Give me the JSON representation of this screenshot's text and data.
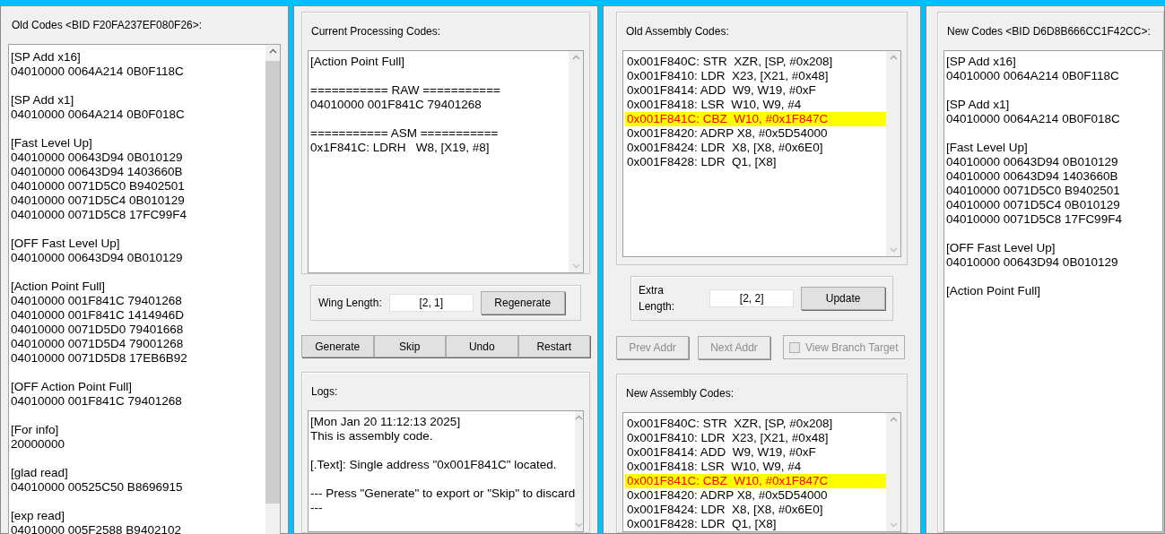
{
  "old_codes": {
    "title": "Old Codes <BID F20FA237EF080F26>:",
    "blocks": [
      [
        "[SP Add x16]",
        "04010000 0064A214 0B0F118C"
      ],
      [
        "[SP Add x1]",
        "04010000 0064A214 0B0F018C"
      ],
      [
        "[Fast Level Up]",
        "04010000 00643D94 0B010129",
        "04010000 00643D94 1403660B",
        "04010000 0071D5C0 B9402501",
        "04010000 0071D5C4 0B010129",
        "04010000 0071D5C8 17FC99F4"
      ],
      [
        "[OFF Fast Level Up]",
        "04010000 00643D94 0B010129"
      ],
      [
        "[Action Point Full]",
        "04010000 001F841C 79401268",
        "04010000 001F841C 1414946D",
        "04010000 0071D5D0 79401668",
        "04010000 0071D5D4 79001268",
        "04010000 0071D5D8 17EB6B92"
      ],
      [
        "[OFF Action Point Full]",
        "04010000 001F841C 79401268"
      ],
      [
        "[For info]",
        "20000000"
      ],
      [
        "[glad read]",
        "04010000 00525C50 B8696915"
      ],
      [
        "[exp read]",
        "04010000 005F2588 B9402102"
      ]
    ]
  },
  "current": {
    "title": "Current Processing Codes:",
    "blocks": [
      [
        "[Action Point Full]"
      ],
      [
        "=========== RAW ===========",
        "04010000 001F841C 79401268"
      ],
      [
        "=========== ASM ===========",
        "0x1F841C: LDRH   W8, [X19, #8]"
      ]
    ]
  },
  "wing": {
    "label": "Wing Length:",
    "value": "[2, 1]",
    "button": "Regenerate"
  },
  "actions": [
    {
      "label": "Generate"
    },
    {
      "label": "Skip"
    },
    {
      "label": "Undo"
    },
    {
      "label": "Restart"
    }
  ],
  "logs": {
    "title": "Logs:",
    "blocks": [
      [
        "[Mon Jan 20 11:12:13 2025]",
        "This is assembly code."
      ],
      [
        "[.Text]: Single address \"0x001F841C\" located."
      ],
      [
        "--- Press \"Generate\" to export or \"Skip\" to discard",
        "---"
      ]
    ]
  },
  "old_asm": {
    "title": "Old Assembly Codes:",
    "lines": [
      {
        "text": "0x001F840C: STR  XZR, [SP, #0x208]",
        "selected": false
      },
      {
        "text": "0x001F8410: LDR  X23, [X21, #0x48]",
        "selected": false
      },
      {
        "text": "0x001F8414: ADD  W9, W19, #0xF",
        "selected": false
      },
      {
        "text": "0x001F8418: LSR  W10, W9, #4",
        "selected": false
      },
      {
        "text": "0x001F841C: CBZ  W10, #0x1F847C",
        "selected": true
      },
      {
        "text": "0x001F8420: ADRP X8, #0x5D54000",
        "selected": false
      },
      {
        "text": "0x001F8424: LDR  X8, [X8, #0x6E0]",
        "selected": false
      },
      {
        "text": "0x001F8428: LDR  Q1, [X8]",
        "selected": false
      }
    ]
  },
  "extra": {
    "label": "Extra Length:",
    "value": "[2, 2]",
    "button": "Update"
  },
  "nav": [
    {
      "label": "Prev Addr",
      "disabled": true
    },
    {
      "label": "Next Addr",
      "disabled": true
    }
  ],
  "branch": {
    "label": "View Branch Target",
    "checked": false,
    "disabled": true
  },
  "new_asm": {
    "title": "New Assembly Codes:",
    "lines": [
      {
        "text": "0x001F840C: STR  XZR, [SP, #0x208]",
        "selected": false
      },
      {
        "text": "0x001F8410: LDR  X23, [X21, #0x48]",
        "selected": false
      },
      {
        "text": "0x001F8414: ADD  W9, W19, #0xF",
        "selected": false
      },
      {
        "text": "0x001F8418: LSR  W10, W9, #4",
        "selected": false
      },
      {
        "text": "0x001F841C: CBZ  W10, #0x1F847C",
        "selected": true
      },
      {
        "text": "0x001F8420: ADRP X8, #0x5D54000",
        "selected": false
      },
      {
        "text": "0x001F8424: LDR  X8, [X8, #0x6E0]",
        "selected": false
      },
      {
        "text": "0x001F8428: LDR  Q1, [X8]",
        "selected": false
      }
    ]
  },
  "new_codes": {
    "title": "New Codes <BID D6D8B666CC1F42CC>:",
    "blocks": [
      [
        "[SP Add x16]",
        "04010000 0064A214 0B0F118C"
      ],
      [
        "[SP Add x1]",
        "04010000 0064A214 0B0F018C"
      ],
      [
        "[Fast Level Up]",
        "04010000 00643D94 0B010129",
        "04010000 00643D94 1403660B",
        "04010000 0071D5C0 B9402501",
        "04010000 0071D5C4 0B010129",
        "04010000 0071D5C8 17FC99F4"
      ],
      [
        "[OFF Fast Level Up]",
        "04010000 00643D94 0B010129"
      ],
      [
        "[Action Point Full]"
      ]
    ]
  }
}
